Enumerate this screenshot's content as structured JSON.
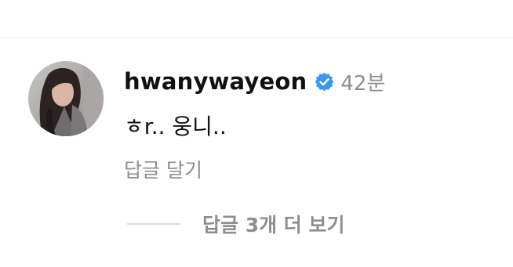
{
  "comment": {
    "username": "hwanywayeon",
    "verified_icon": "verified-badge-icon",
    "timestamp": "42분",
    "text": "ㅎr.. 웅니..",
    "reply_label": "답글 달기",
    "avatar_icon": "user-avatar"
  },
  "replies": {
    "view_label": "답글 3개 더 보기"
  },
  "colors": {
    "text_primary": "#111111",
    "text_secondary": "#8e8e8e",
    "verified_blue": "#3897f0",
    "divider": "#efefef",
    "reply_line": "#dcdcdc"
  }
}
